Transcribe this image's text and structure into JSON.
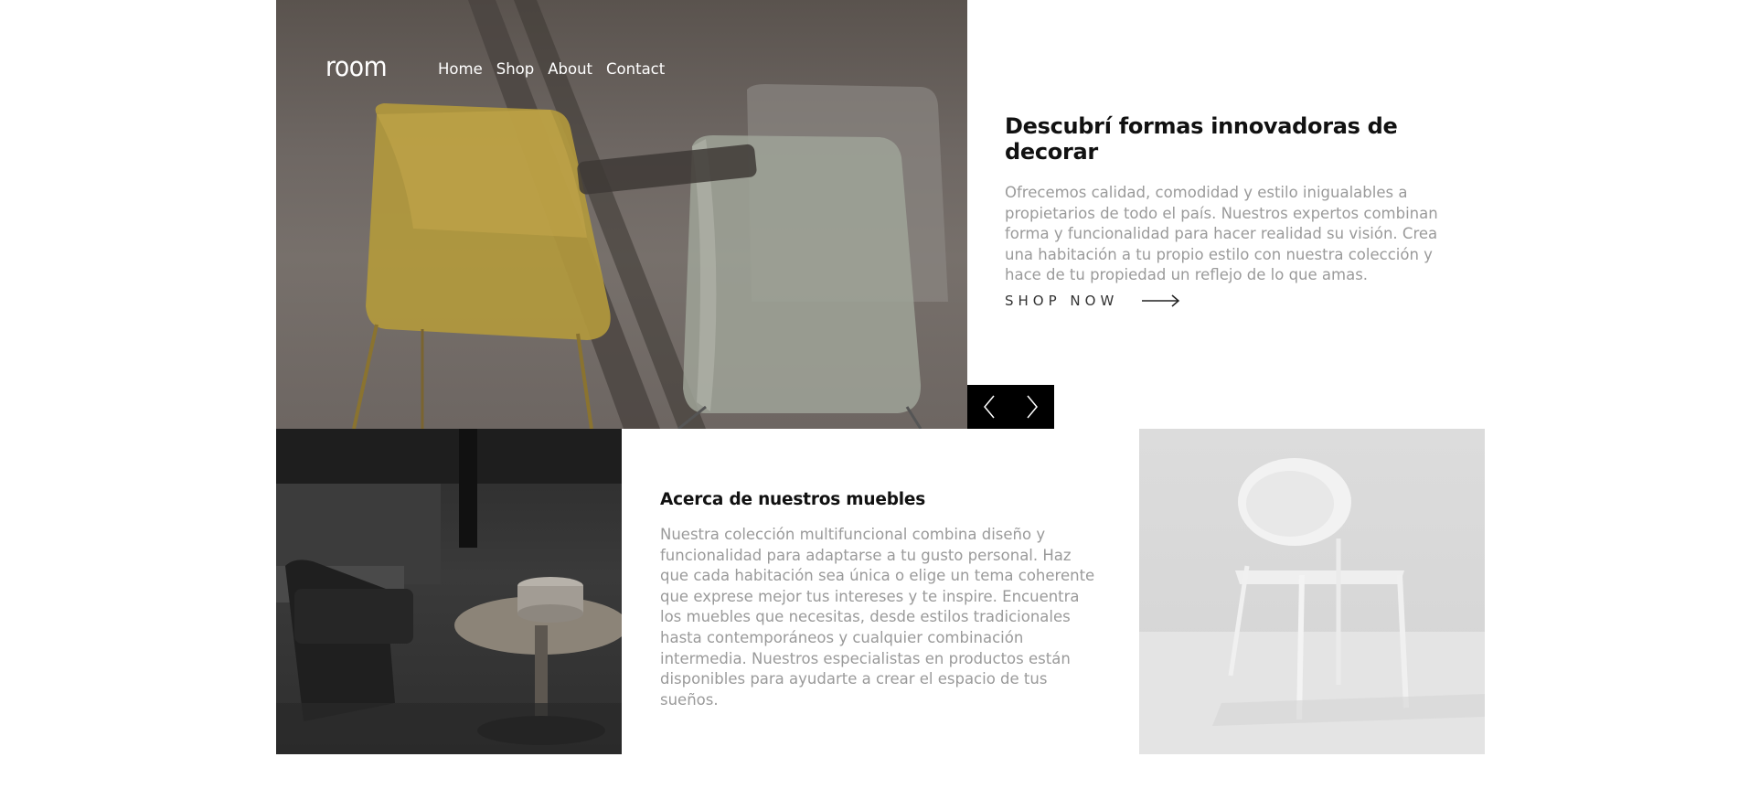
{
  "brand": {
    "logo": "room"
  },
  "nav": {
    "items": [
      {
        "label": "Home"
      },
      {
        "label": "Shop"
      },
      {
        "label": "About"
      },
      {
        "label": "Contact"
      }
    ]
  },
  "hero": {
    "title": "Descubrí formas innovadoras de decorar",
    "body": "Ofrecemos calidad, comodidad y estilo inigualables a propietarios de todo el país. Nuestros expertos combinan forma y funcionalidad para hacer realidad su visión. Crea una habitación a tu propio estilo con nuestra colección y hace de tu propiedad un reflejo de lo que amas.",
    "cta_label": "SHOP NOW",
    "cta_icon": "arrow-right-icon"
  },
  "slider": {
    "prev_icon": "chevron-left-icon",
    "next_icon": "chevron-right-icon"
  },
  "about": {
    "title": "Acerca de nuestros muebles",
    "body": "Nuestra colección multifuncional combina diseño y funcionalidad para adaptarse a tu gusto personal. Haz que cada habitación sea única o elige un tema coherente que exprese mejor tus intereses y te inspire. Encuentra los muebles que necesitas, desde estilos tradicionales hasta contemporáneos y cualquier combinación intermedia. Nuestros especialistas en productos están disponibles para ayudarte a crear el espacio de tus sueños."
  },
  "colors": {
    "text_dark": "#111111",
    "text_muted": "#9a9a9a",
    "control_bg": "#000000"
  }
}
